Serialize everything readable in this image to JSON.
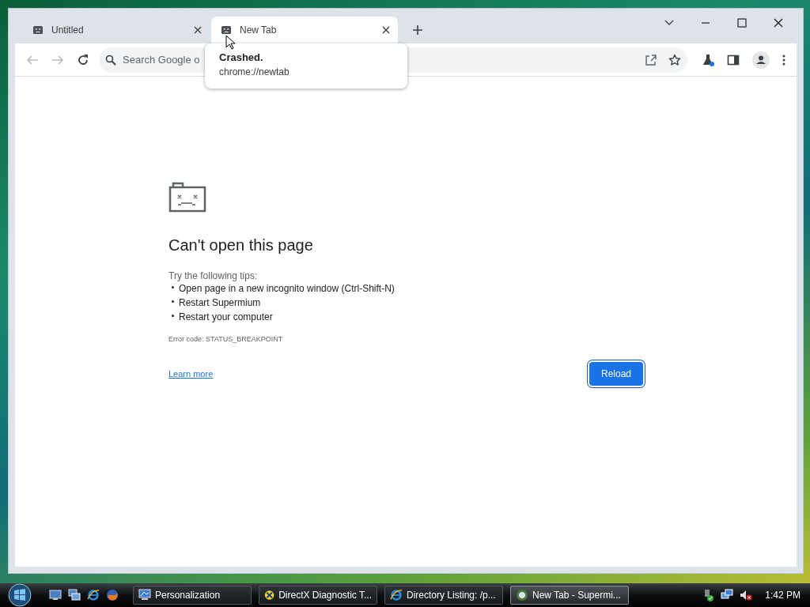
{
  "tabs": [
    {
      "title": "Untitled",
      "selected": false
    },
    {
      "title": "New Tab",
      "selected": true
    }
  ],
  "tooltip": {
    "title": "Crashed.",
    "url": "chrome://newtab"
  },
  "omnibox": {
    "placeholder": "Search Google o"
  },
  "error_page": {
    "heading": "Can't open this page",
    "tips_intro": "Try the following tips:",
    "tips": [
      "Open page in a new incognito window (Ctrl-Shift-N)",
      "Restart Supermium",
      "Restart your computer"
    ],
    "error_code": "Error code: STATUS_BREAKPOINT",
    "link": "Learn more",
    "button": "Reload"
  },
  "taskbar": {
    "buttons": [
      {
        "label": "Personalization",
        "kind": "monitor",
        "selected": false
      },
      {
        "label": "DirectX Diagnostic T...",
        "kind": "directx",
        "selected": false
      },
      {
        "label": "Directory Listing: /p...",
        "kind": "ie",
        "selected": false
      },
      {
        "label": "New Tab - Supermi...",
        "kind": "chrome",
        "selected": true
      }
    ],
    "clock": "1:42 PM"
  }
}
